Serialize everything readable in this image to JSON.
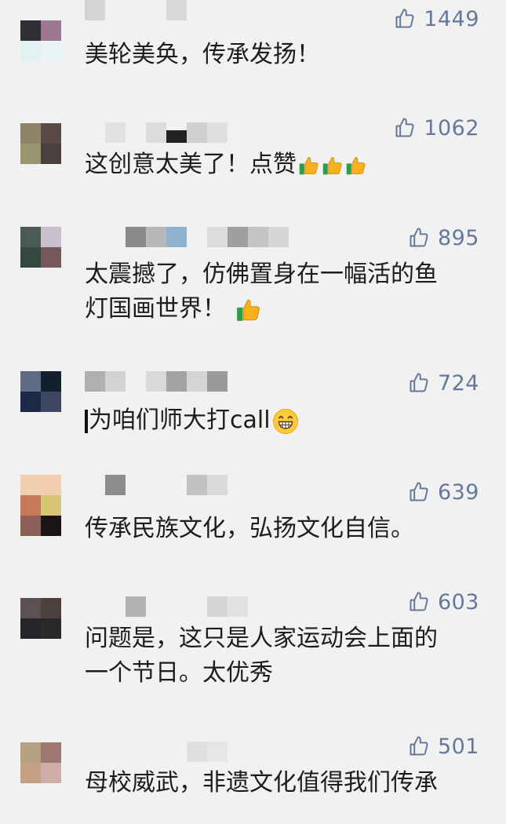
{
  "comments": [
    {
      "avatar": [
        "#2f2f34",
        "#9c7893",
        "#e3f2f0",
        "#e8f5f4"
      ],
      "like_count": "1449",
      "lines": [
        "美轮美奂，传承发扬！"
      ]
    },
    {
      "avatar": [
        "#8d8468",
        "#5a4946",
        "#9a9473",
        "#4b403d"
      ],
      "like_count": "1062",
      "lines": [
        "这创意太美了！点赞"
      ]
    },
    {
      "avatar": [
        "#4b5a52",
        "#c8c0cc",
        "#344843",
        "#75585c"
      ],
      "like_count": "895",
      "lines": [
        "太震撼了，仿佛置身在一幅活的鱼",
        "灯国画世界！"
      ]
    },
    {
      "avatar": [
        "#5d6b86",
        "#11202c",
        "#1b2a48",
        "#3f4664"
      ],
      "like_count": "724",
      "lines": [
        "为咱们师大打call"
      ]
    },
    {
      "avatar": [
        "#f0cfb2",
        "#f2cfb3",
        "#c9775b",
        "#d8c677",
        "#8c5f59",
        "#1a1414"
      ],
      "like_count": "639",
      "lines": [
        "传承民族文化，弘扬文化自信。"
      ]
    },
    {
      "avatar": [
        "#5c5253",
        "#4f4040",
        "#25262a",
        "#29292c"
      ],
      "like_count": "603",
      "lines": [
        "问题是，这只是人家运动会上面的",
        "一个节日。太优秀"
      ]
    },
    {
      "avatar": [
        "#b5a182",
        "#9d7770",
        "#c4a085",
        "#ceada7"
      ],
      "like_count": "501",
      "lines": [
        "母校威武，非遗文化值得我们传承"
      ]
    }
  ],
  "icons": {
    "like": "thumbs-up-outline-icon",
    "emoji_thumb": "thumbs-up-emoji-icon",
    "emoji_grin": "grinning-face-emoji-icon"
  },
  "colors": {
    "background": "#f1f1f1",
    "text": "#1d1d1d",
    "like": "#65789a"
  }
}
